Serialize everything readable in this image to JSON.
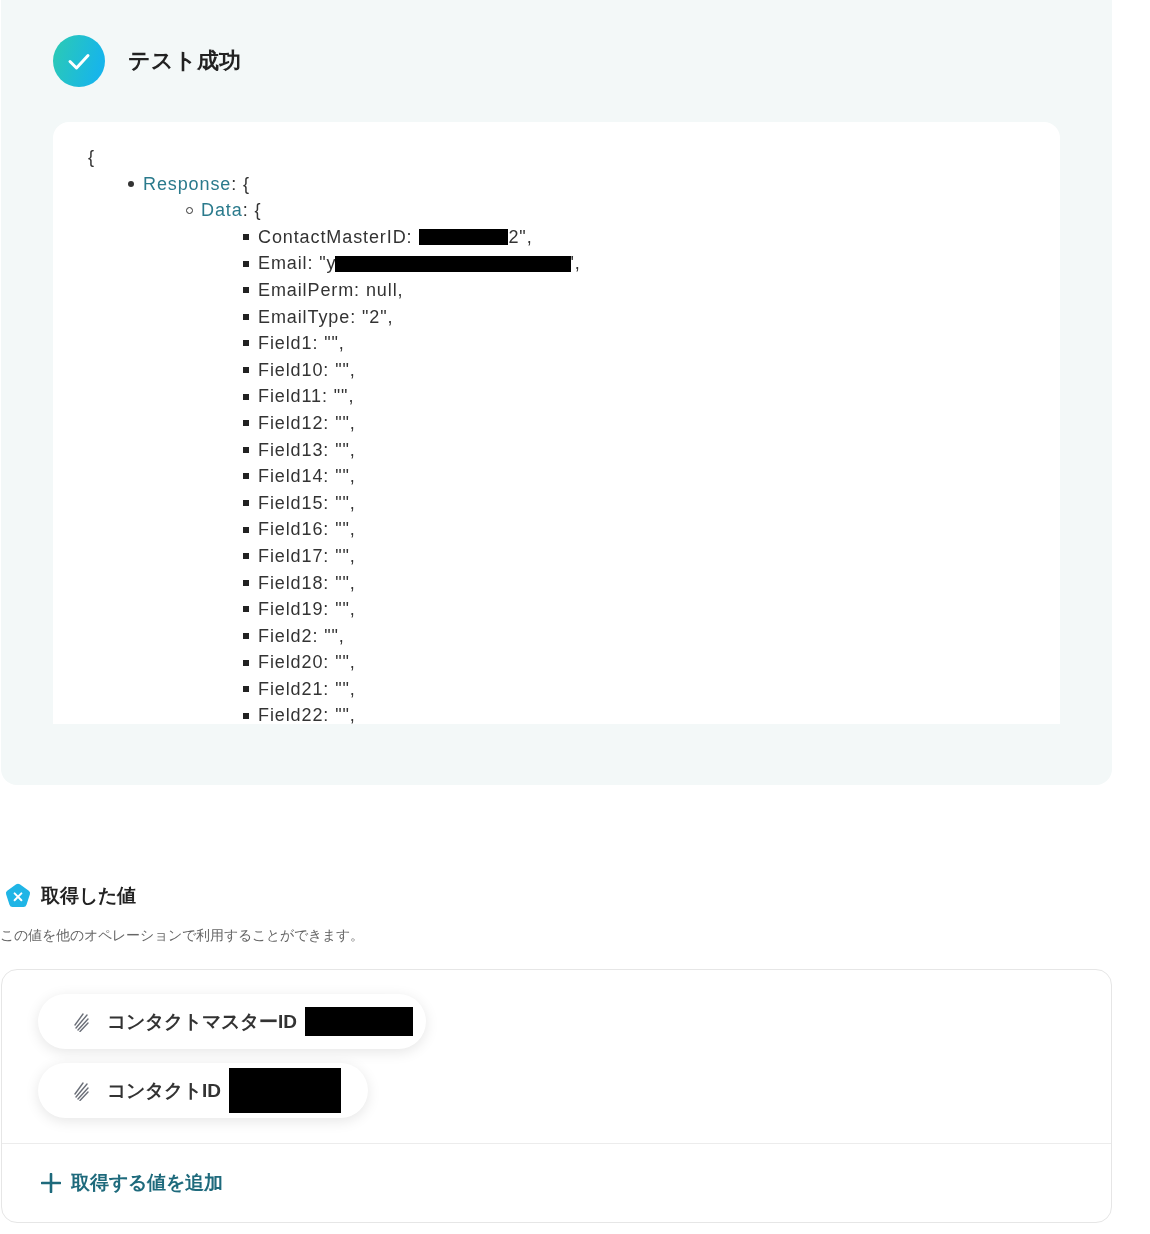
{
  "result": {
    "succeeded": true,
    "title": "テスト成功",
    "json_preview": {
      "open": "{",
      "children": [
        {
          "key": "Response",
          "punct": ": {",
          "children": [
            {
              "key": "Data",
              "punct": ": {",
              "children": [
                {
                  "text": "ContactMasterID:",
                  "redacted": true,
                  "tail": "2\","
                },
                {
                  "text": "Email: \"y",
                  "redacted": true,
                  "tail": "',"
                },
                {
                  "text": "EmailPerm: null,"
                },
                {
                  "text": "EmailType: \"2\","
                },
                {
                  "text": "Field1: \"\","
                },
                {
                  "text": "Field10: \"\","
                },
                {
                  "text": "Field11: \"\","
                },
                {
                  "text": "Field12: \"\","
                },
                {
                  "text": "Field13: \"\","
                },
                {
                  "text": "Field14: \"\","
                },
                {
                  "text": "Field15: \"\","
                },
                {
                  "text": "Field16: \"\","
                },
                {
                  "text": "Field17: \"\","
                },
                {
                  "text": "Field18: \"\","
                },
                {
                  "text": "Field19: \"\","
                },
                {
                  "text": "Field2: \"\","
                },
                {
                  "text": "Field20: \"\","
                },
                {
                  "text": "Field21: \"\","
                },
                {
                  "text": "Field22: \"\","
                }
              ]
            }
          ]
        }
      ]
    }
  },
  "output": {
    "title": "取得した値",
    "description": "この値を他のオペレーションで利用することができます。",
    "values": [
      {
        "label": "コンタクトマスターID",
        "redacted": true
      },
      {
        "label": "コンタクトID",
        "redacted": true
      }
    ],
    "add_button": "取得する値を追加"
  }
}
